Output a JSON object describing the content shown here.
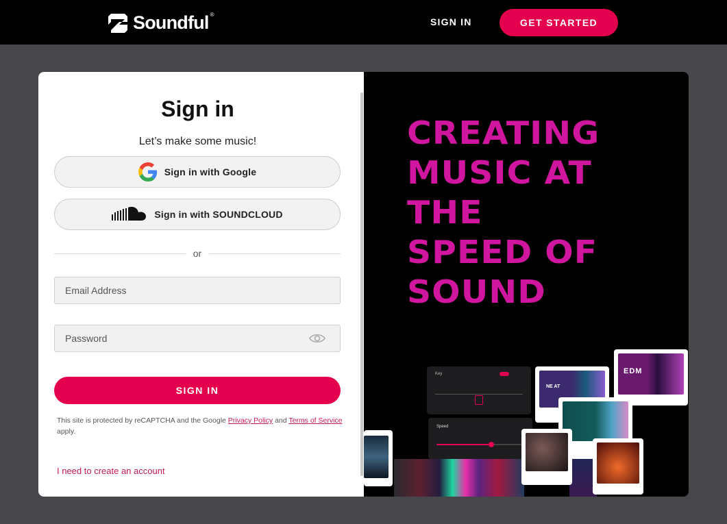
{
  "header": {
    "brand": "Soundful",
    "signin_label": "SIGN IN",
    "get_started_label": "GET STARTED"
  },
  "login": {
    "title": "Sign in",
    "subtitle": "Let’s make some music!",
    "google_label": "Sign in with Google",
    "soundcloud_label": "Sign in with SOUNDCLOUD",
    "divider_text": "or",
    "email_placeholder": "Email Address",
    "password_placeholder": "Password",
    "submit_label": "SIGN IN",
    "recaptcha": {
      "prefix": "This site is protected by reCAPTCHA and the Google ",
      "privacy": "Privacy Policy",
      "and": " and ",
      "terms": "Terms of Service",
      "suffix": " apply."
    },
    "create_account": "I need to create an account"
  },
  "promo": {
    "headline_lines": [
      "CREATING",
      "MUSIC AT",
      "THE",
      "SPEED OF",
      "SOUND"
    ],
    "key_label": "Key",
    "speed_label": "Speed",
    "tile_labels": {
      "neat": "NE AT",
      "edm": "EDM"
    }
  },
  "colors": {
    "accent": "#e5004f",
    "headline": "#d0169e",
    "page_bg": "#47464a",
    "nav_bg": "#000000",
    "link": "#c2185b"
  }
}
